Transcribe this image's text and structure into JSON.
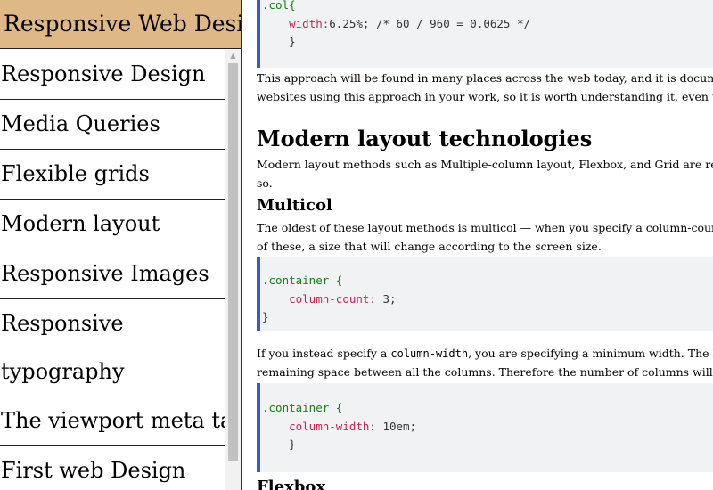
{
  "sidebar": {
    "title": "Responsive Web Design",
    "items": [
      {
        "label": "Responsive Design"
      },
      {
        "label": "Media Queries"
      },
      {
        "label": "Flexible grids"
      },
      {
        "label": "Modern layout"
      },
      {
        "label": "Responsive Images"
      },
      {
        "label_line1": "Responsive",
        "label_line2": "typography"
      },
      {
        "label": "The viewport meta tag"
      },
      {
        "label": "First web Design"
      }
    ],
    "scroll_up_glyph": "▲"
  },
  "main": {
    "code1": {
      "selector": ".col{",
      "property": "width:",
      "value": "6.25%; /* 60 / 960 = 0.0625 */",
      "close": "}"
    },
    "para1_line1": "This approach will be found in many places across the web today, and it is documented here in",
    "para1_line2": "websites using this approach in your work, so it is worth understanding it, even though you wo",
    "heading_modern": "Modern layout technologies",
    "para2_line1": "Modern layout methods such as Multiple-column layout, Flexbox, and Grid are responsive by d",
    "para2_line2": "so.",
    "heading_multicol": "Multicol",
    "para3_line1": "The oldest of these layout methods is multicol — when you specify a column-count, this indica",
    "para3_line2": "of these, a size that will change according to the screen size.",
    "code2": {
      "selector": ".container {",
      "property": "column-count",
      "value": ": 3;",
      "close": "}"
    },
    "para4_line1_a": "If you instead specify a ",
    "para4_line1_code": "column-width",
    "para4_line1_b": ", you are specifying a minimum width. The browser w",
    "para4_line2": "remaining space between all the columns. Therefore the number of columns will change accord",
    "code3": {
      "selector": ".container {",
      "property": "column-width",
      "value": ": 10em;",
      "close": "}"
    },
    "heading_flexbox": "Flexbox"
  }
}
